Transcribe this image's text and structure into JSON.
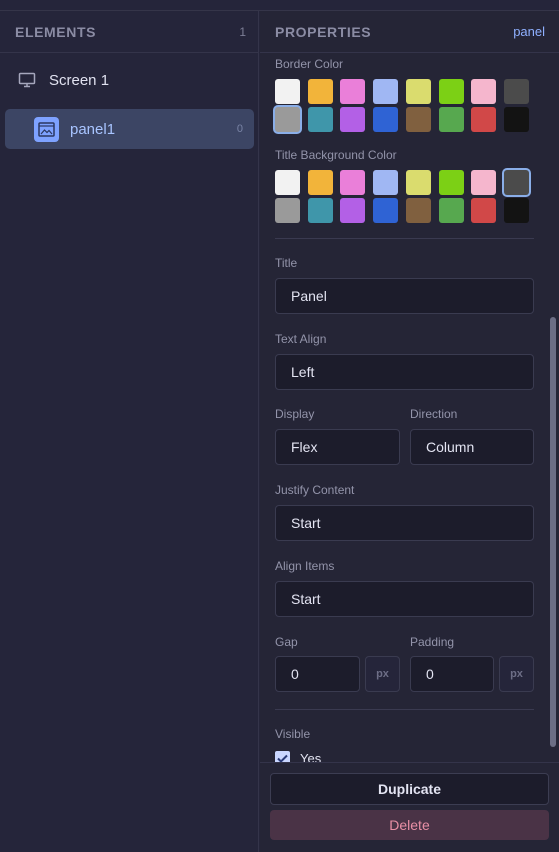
{
  "elements_panel": {
    "header": "ELEMENTS",
    "count": "1",
    "screen_label": "Screen 1",
    "panel_label": "panel1",
    "panel_count": "0"
  },
  "properties_panel": {
    "header": "PROPERTIES",
    "element_type": "panel",
    "border_color_label": "Border Color",
    "title_bg_label": "Title Background Color",
    "palette": [
      "#f2f2f2",
      "#f2b43a",
      "#ea7fd9",
      "#a0b7f3",
      "#dadc6e",
      "#7cd015",
      "#f5b6cd",
      "#4b4b4b",
      "#9a9a9a",
      "#3f96aa",
      "#b360e6",
      "#2f63d4",
      "#80603f",
      "#57a84f",
      "#d14848",
      "#131313"
    ],
    "border_color_selected_index": 8,
    "title_bg_selected_index": 7,
    "title_label": "Title",
    "title_value": "Panel",
    "text_align_label": "Text Align",
    "text_align_value": "Left",
    "display_label": "Display",
    "display_value": "Flex",
    "direction_label": "Direction",
    "direction_value": "Column",
    "justify_label": "Justify Content",
    "justify_value": "Start",
    "align_items_label": "Align Items",
    "align_items_value": "Start",
    "gap_label": "Gap",
    "gap_value": "0",
    "gap_unit": "px",
    "padding_label": "Padding",
    "padding_value": "0",
    "padding_unit": "px",
    "visible_label": "Visible",
    "visible_option": "Yes",
    "visible_checked": true
  },
  "footer": {
    "duplicate_label": "Duplicate",
    "delete_label": "Delete"
  }
}
